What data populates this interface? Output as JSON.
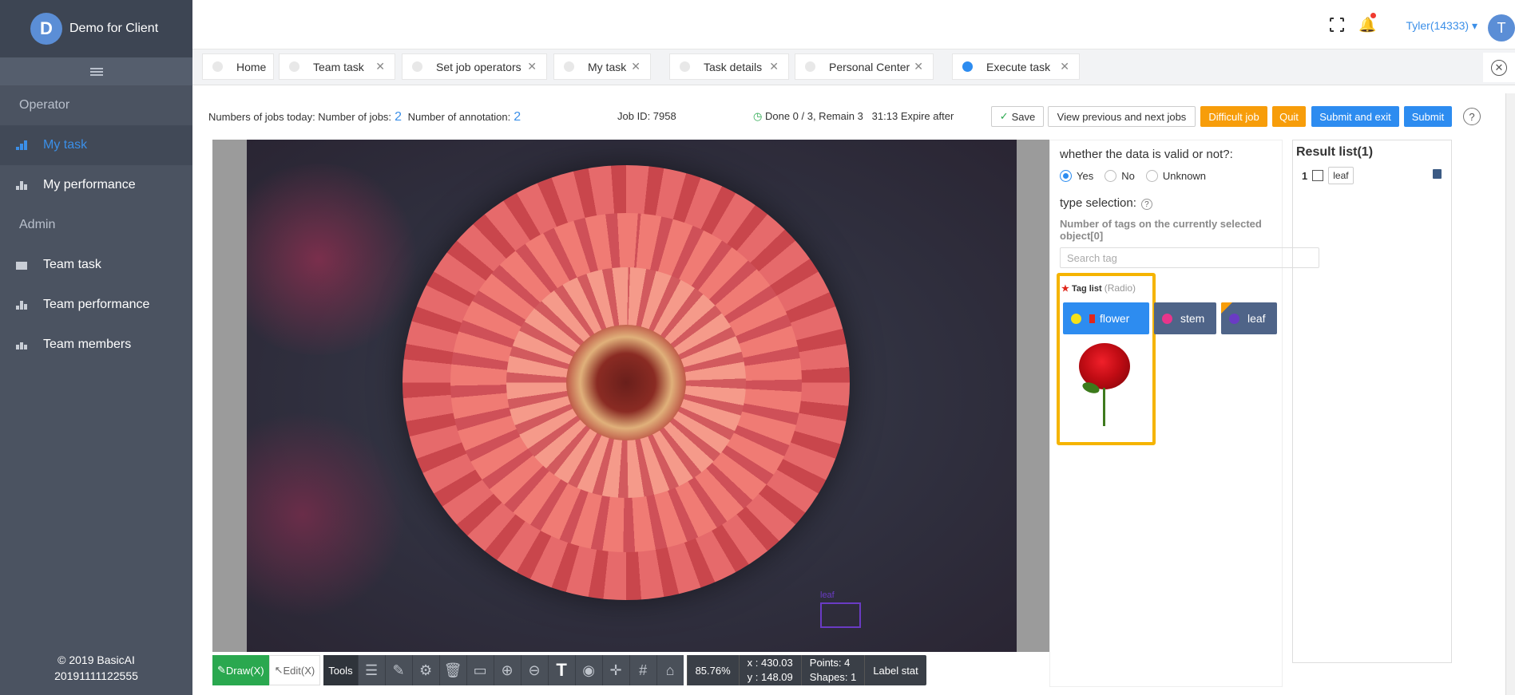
{
  "brand": {
    "logo_letter": "D",
    "name": "Demo for Client"
  },
  "sidebar": {
    "sections": [
      {
        "title": "Operator",
        "items": [
          {
            "label": "My task",
            "icon": "layers-icon",
            "active": true
          },
          {
            "label": "My performance",
            "icon": "bar-chart-icon",
            "active": false
          }
        ]
      },
      {
        "title": "Admin",
        "items": [
          {
            "label": "Team task",
            "icon": "briefcase-icon",
            "active": false
          },
          {
            "label": "Team performance",
            "icon": "bar-chart-icon",
            "active": false
          },
          {
            "label": "Team members",
            "icon": "users-icon",
            "active": false
          }
        ]
      }
    ],
    "copyright": "© 2019 BasicAI",
    "build": "20191111122555"
  },
  "header": {
    "user": "Tyler(14333)",
    "avatar_letter": "T"
  },
  "tabs": [
    {
      "label": "Home",
      "closable": false,
      "active": false
    },
    {
      "label": "Team task",
      "closable": true,
      "active": false
    },
    {
      "label": "Set job operators",
      "closable": true,
      "active": false
    },
    {
      "label": "My task",
      "closable": true,
      "active": false
    },
    {
      "label": "Task details",
      "closable": true,
      "active": false
    },
    {
      "label": "Personal Center",
      "closable": true,
      "active": false
    },
    {
      "label": "Execute task",
      "closable": true,
      "active": true
    }
  ],
  "info": {
    "jobs_today_label": "Numbers of jobs today: Number of jobs:",
    "jobs_count": "2",
    "annotation_label": "Number of annotation:",
    "annotation_count": "2",
    "job_id": "Job ID: 7958",
    "progress": "Done 0 / 3, Remain 3",
    "expire": "31:13 Expire after"
  },
  "actions": {
    "save": "Save",
    "view_prev_next": "View previous and next jobs",
    "difficult": "Difficult job",
    "quit": "Quit",
    "submit_exit": "Submit and exit",
    "submit": "Submit",
    "help": "?"
  },
  "canvas": {
    "bbox_label": "leaf"
  },
  "toolbar": {
    "draw": "Draw(X)",
    "edit": "Edit(X)",
    "tools_label": "Tools",
    "zoom": "85.76%",
    "x": "x : 430.03",
    "y": "y : 148.09",
    "points": "Points:  4",
    "shapes": "Shapes:  1",
    "label_stat": "Label stat",
    "text_icon_glyph": "T"
  },
  "panel": {
    "validity_question": "whether the data is valid or not?:",
    "options": [
      "Yes",
      "No",
      "Unknown"
    ],
    "selected_option": "Yes",
    "type_selection": "type selection:",
    "tag_count": "Number of tags on the currently selected object[0]",
    "search_placeholder": "Search tag",
    "tag_list_title": "Tag list",
    "tag_list_mode": "(Radio)",
    "tags": [
      {
        "label": "flower",
        "color": "#f5e11a",
        "bg": "#2d8cf0"
      },
      {
        "label": "stem",
        "color": "#e8358b",
        "bg": "#4f6488"
      },
      {
        "label": "leaf",
        "color": "#6a3bc4",
        "bg": "#4f6488"
      }
    ]
  },
  "result": {
    "title": "Result list(1)",
    "items": [
      {
        "index": "1",
        "label": "leaf"
      }
    ]
  }
}
